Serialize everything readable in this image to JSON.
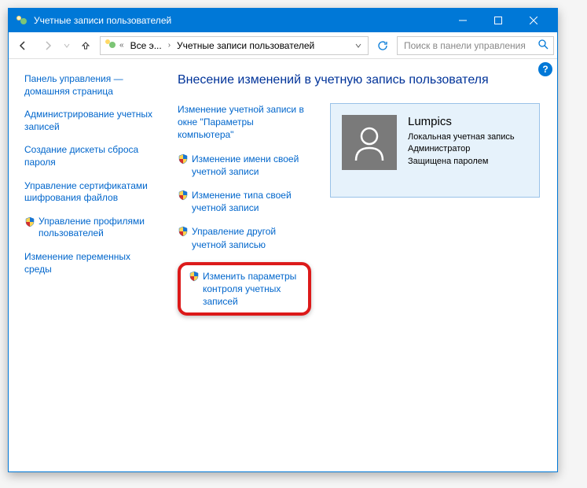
{
  "window": {
    "title": "Учетные записи пользователей"
  },
  "breadcrumb": {
    "seg1": "Все э...",
    "seg2": "Учетные записи пользователей"
  },
  "search": {
    "placeholder": "Поиск в панели управления"
  },
  "sidebar": {
    "items": [
      {
        "label": "Панель управления — домашняя страница",
        "shield": false
      },
      {
        "label": "Администрирование учетных записей",
        "shield": false
      },
      {
        "label": "Создание дискеты сброса пароля",
        "shield": false
      },
      {
        "label": "Управление сертификатами шифрования файлов",
        "shield": false
      },
      {
        "label": "Управление профилями пользователей",
        "shield": true
      },
      {
        "label": "Изменение переменных среды",
        "shield": false
      }
    ]
  },
  "main": {
    "heading": "Внесение изменений в учетную запись пользователя",
    "tasks": [
      {
        "label": "Изменение учетной записи в окне \"Параметры компьютера\"",
        "shield": false
      },
      {
        "label": "Изменение имени своей учетной записи",
        "shield": true
      },
      {
        "label": "Изменение типа своей учетной записи",
        "shield": true
      },
      {
        "label": "Управление другой учетной записью",
        "shield": true
      },
      {
        "label": "Изменить параметры контроля учетных записей",
        "shield": true,
        "highlight": true
      }
    ]
  },
  "user": {
    "name": "Lumpics",
    "line1": "Локальная учетная запись",
    "line2": "Администратор",
    "line3": "Защищена паролем"
  }
}
